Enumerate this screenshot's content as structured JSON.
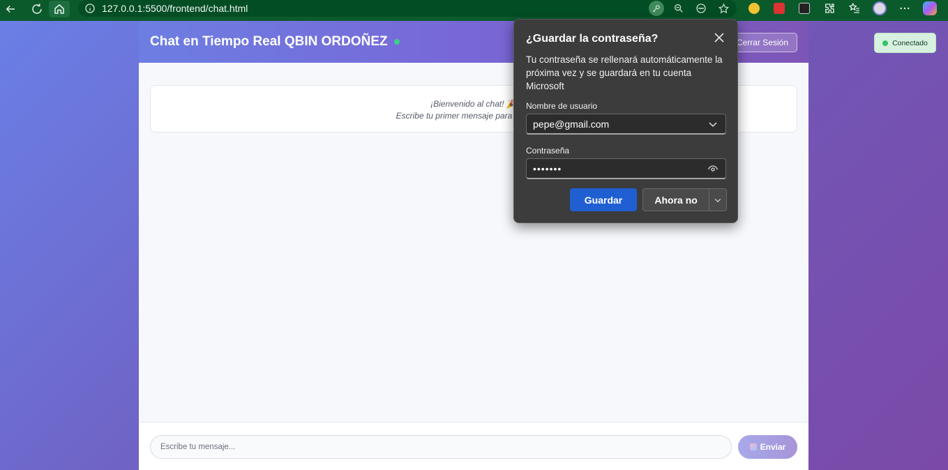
{
  "browser": {
    "url": "127.0.0.1:5500/frontend/chat.html"
  },
  "page": {
    "status_badge": "Conectado",
    "chat": {
      "title": "Chat en Tiempo Real QBIN ORDOÑEZ",
      "logout_label": "Cerrar Sesión",
      "welcome_line1": "¡Bienvenido al chat! 🎉",
      "welcome_line2": "Escribe tu primer mensaje para comenzar",
      "input_placeholder": "Escribe tu mensaje...",
      "send_label": "Enviar"
    }
  },
  "password_dialog": {
    "title": "¿Guardar la contraseña?",
    "description": "Tu contraseña se rellenará automáticamente la próxima vez y se guardará en tu cuenta Microsoft",
    "username_label": "Nombre de usuario",
    "username_value": "pepe@gmail.com",
    "password_label": "Contraseña",
    "password_value": "•••••••",
    "save_label": "Guardar",
    "not_now_label": "Ahora no"
  }
}
